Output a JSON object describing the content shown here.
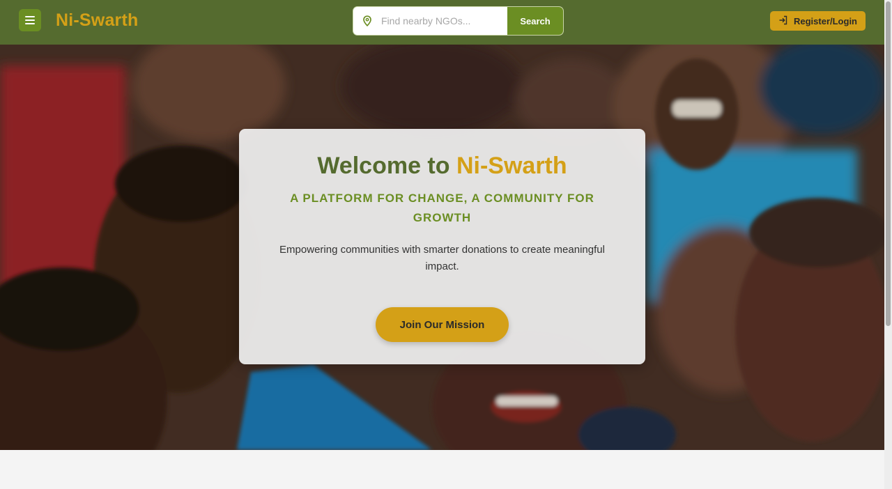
{
  "header": {
    "brand": "Ni-Swarth",
    "menu_icon": "hamburger-menu-icon",
    "search": {
      "placeholder": "Find nearby NGOs...",
      "value": "",
      "icon": "location-pin-icon",
      "button_label": "Search"
    },
    "login": {
      "label": "Register/Login",
      "icon": "login-icon"
    }
  },
  "hero": {
    "title_prefix": "Welcome to",
    "title_accent": "Ni-Swarth",
    "subtitle": "A PLATFORM FOR CHANGE, A COMMUNITY FOR GROWTH",
    "description": "Empowering communities with smarter donations to create meaningful impact.",
    "cta_label": "Join Our Mission"
  },
  "colors": {
    "nav_bg": "#556b2f",
    "accent_gold": "#d4a017",
    "olive": "#6b8e23"
  }
}
